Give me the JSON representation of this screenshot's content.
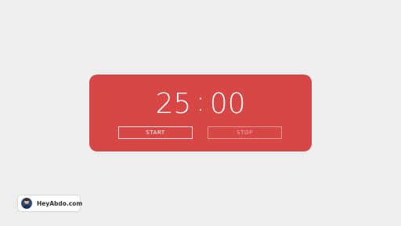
{
  "timer": {
    "minutes": "25",
    "separator": ":",
    "seconds": "00"
  },
  "controls": {
    "start_label": "START",
    "stop_label": "STOP"
  },
  "brand": {
    "label": "HeyAbdo.com"
  },
  "colors": {
    "background": "#eeeeee",
    "card": "#d64745",
    "text": "#ffffff"
  }
}
